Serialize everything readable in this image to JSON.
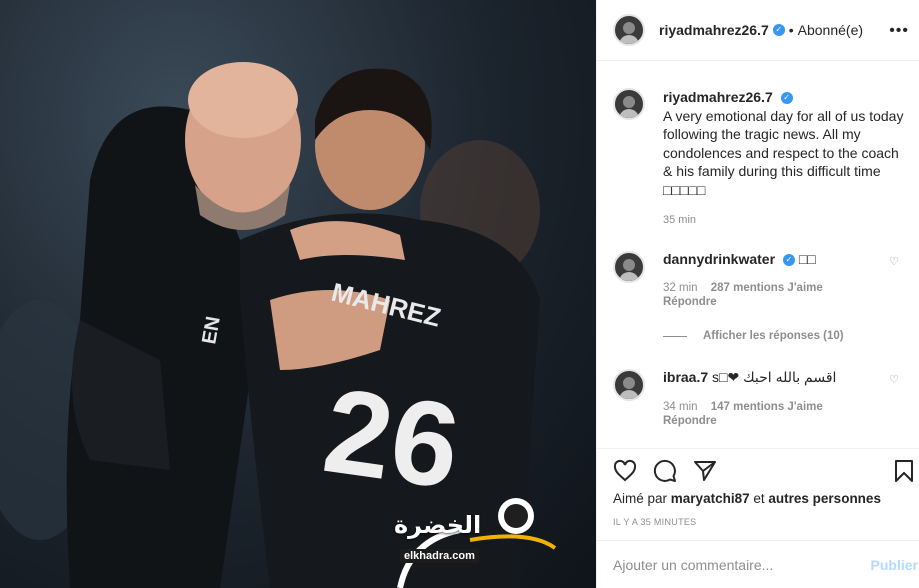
{
  "post": {
    "username": "riyadmahrez26.7",
    "follow_label": "Abonné(e)",
    "separator": "•",
    "more_label": "•••",
    "caption_text": "A very emotional day for all of us today following the tragic news. All my condolences and respect to the coach & his family during this difficult time □□□□□",
    "caption_time": "35 min"
  },
  "photo": {
    "jersey_name": "MAHREZ",
    "jersey_number": "26",
    "watermark_arabic": "الخضرة",
    "watermark_url": "elkhadra.com"
  },
  "comments": [
    {
      "username": "dannydrinkwater",
      "text": "□□",
      "time": "32 min",
      "likes": "287 mentions J'aime",
      "reply": "Répondre"
    },
    {
      "username": "ibraa.7",
      "text": "s□❤ اقسم بالله احبك",
      "time": "34 min",
      "likes": "147 mentions J'aime",
      "reply": "Répondre"
    }
  ],
  "see_replies": "Afficher les réponses (10)",
  "actions": {
    "like_icon": "heart-icon",
    "comment_icon": "comment-icon",
    "share_icon": "send-icon",
    "save_icon": "bookmark-icon"
  },
  "likes_line": {
    "prefix": "Aimé par",
    "user": "maryatchi87",
    "middle": "et",
    "suffix": "autres personnes"
  },
  "posted_ago": "IL Y A 35 MINUTES",
  "add_comment": {
    "placeholder": "Ajouter un commentaire...",
    "publish": "Publier"
  },
  "colors": {
    "verified": "#3897f0",
    "muted": "#8e8e8e",
    "publish_disabled": "#b3dbff"
  }
}
